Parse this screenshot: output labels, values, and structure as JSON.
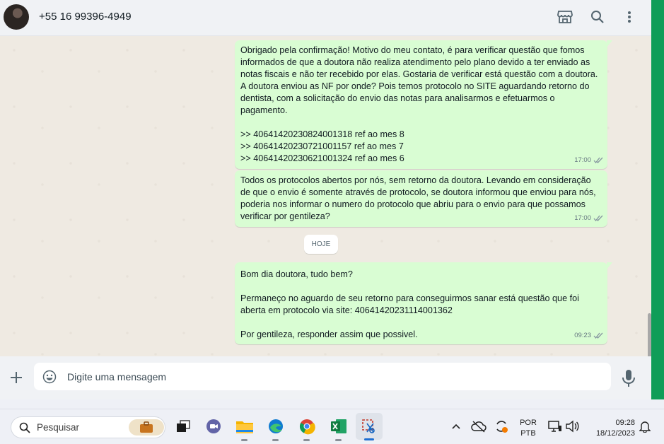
{
  "header": {
    "contact_name": "+55 16 99396-4949",
    "icons": [
      "store-icon",
      "search-icon",
      "menu-icon"
    ]
  },
  "messages": [
    {
      "text": "Obrigado pela confirmação! Motivo do meu contato, é para verificar questão que fomos informados de que a doutora não realiza atendimento pelo plano devido a ter enviado as notas fiscais e não ter recebido por elas. Gostaria de verificar está questão com a doutora. A doutora enviou as NF por onde? Pois temos protocolo no SITE aguardando retorno do dentista, com a solicitação do envio das notas para analisarmos e efetuarmos o pagamento.\n\n>> 40641420230824001318 ref ao mes 8\n>> 40641420230721001157 ref ao mes 7\n>> 40641420230621001324 ref ao mes 6",
      "time": "17:00"
    },
    {
      "text": "Todos os protocolos abertos por nós, sem retorno da doutora. Levando em consideração de que o envio é somente através de protocolo, se doutora informou que enviou para nós, poderia nos informar o numero do protocolo que abriu para o envio para que possamos verificar por gentileza?",
      "time": "17:00"
    },
    {
      "text": "Bom dia doutora, tudo bem?\n\nPermaneço no aguardo de seu retorno para conseguirmos sanar está questão que foi aberta em protocolo via site: 40641420231114001362\n\nPor gentileza, responder assim que possivel.",
      "time": "09:23"
    }
  ],
  "day_chip": "HOJE",
  "composer": {
    "placeholder": "Digite uma mensagem"
  },
  "taskbar": {
    "search_label": "Pesquisar",
    "lang_top": "POR",
    "lang_bottom": "PTB",
    "time": "09:28",
    "date": "18/12/2023"
  },
  "colors": {
    "bubble_out": "#d9fdd3",
    "chat_bg": "#efeae2",
    "accent_green": "#0f9d58"
  }
}
